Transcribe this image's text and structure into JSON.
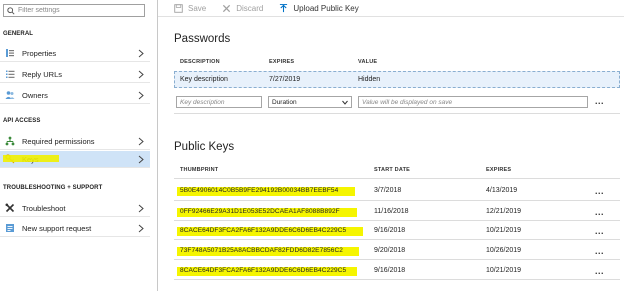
{
  "sidebar": {
    "filter_placeholder": "Filter settings",
    "sections": {
      "general": "GENERAL",
      "api_access": "API ACCESS",
      "troubleshooting": "TROUBLESHOOTING + SUPPORT"
    },
    "items": [
      {
        "label": "Properties",
        "icon": "properties-icon"
      },
      {
        "label": "Reply URLs",
        "icon": "list-icon"
      },
      {
        "label": "Owners",
        "icon": "people-icon"
      },
      {
        "label": "Required permissions",
        "icon": "permissions-icon"
      },
      {
        "label": "Keys",
        "icon": "key-icon",
        "selected": true
      },
      {
        "label": "Troubleshoot",
        "icon": "wrench-icon"
      },
      {
        "label": "New support request",
        "icon": "support-request-icon"
      }
    ]
  },
  "toolbar": {
    "save_label": "Save",
    "discard_label": "Discard",
    "upload_label": "Upload Public Key"
  },
  "passwords": {
    "title": "Passwords",
    "columns": [
      "DESCRIPTION",
      "EXPIRES",
      "VALUE"
    ],
    "rows": [
      {
        "description": "Key description",
        "expires": "7/27/2019",
        "value": "Hidden"
      }
    ],
    "new_row": {
      "description_placeholder": "Key description",
      "duration_value": "Duration",
      "value_placeholder": "Value will be displayed on save"
    },
    "more_label": "..."
  },
  "public_keys": {
    "title": "Public Keys",
    "columns": [
      "THUMBPRINT",
      "START DATE",
      "EXPIRES"
    ],
    "rows": [
      {
        "thumbprint": "5B0E4906014C0B5B9FE294192B00034BB7EEBF54",
        "start": "3/7/2018",
        "expires": "4/13/2019"
      },
      {
        "thumbprint": "0FF92466E29A31D1E053E52DCAEA1AF8088B892F",
        "start": "11/16/2018",
        "expires": "12/21/2019"
      },
      {
        "thumbprint": "8CACE64DF3FCA2FA6F132A9DDE6C6D6EB4C229C5",
        "start": "9/16/2018",
        "expires": "10/21/2019"
      },
      {
        "thumbprint": "73F748A5071B25A8ACBBCDAF82FDD6D82E7856C2",
        "start": "9/20/2018",
        "expires": "10/26/2019"
      },
      {
        "thumbprint": "8CACE64DF3FCA2FA6F132A9DDE6C6D6EB4C229C5",
        "start": "9/16/2018",
        "expires": "10/21/2019"
      }
    ],
    "more_label": "..."
  },
  "colors": {
    "highlight": "#f5f500",
    "selected_nav": "#cfe3f7",
    "accent": "#0072c6"
  }
}
